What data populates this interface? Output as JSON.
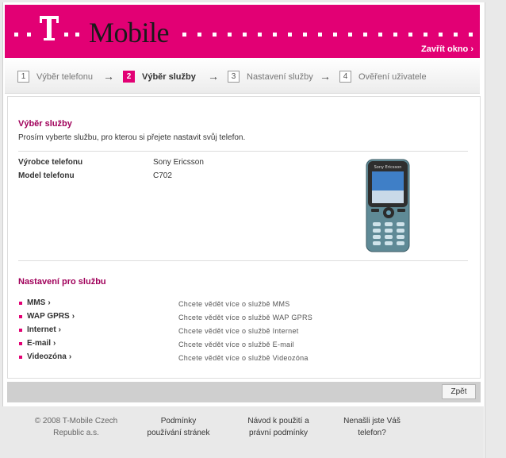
{
  "header": {
    "brand": "Mobile",
    "close_label": "Zavřít okno ›"
  },
  "steps": [
    {
      "num": "1",
      "label": "Výběr telefonu"
    },
    {
      "num": "2",
      "label": "Výběr služby"
    },
    {
      "num": "3",
      "label": "Nastavení služby"
    },
    {
      "num": "4",
      "label": "Ověření uživatele"
    }
  ],
  "step_arrow": "→",
  "selection": {
    "title": "Výběr služby",
    "instruction": "Prosím vyberte službu, pro kterou si přejete nastavit svůj telefon.",
    "manufacturer_label": "Výrobce telefonu",
    "manufacturer_value": "Sony Ericsson",
    "model_label": "Model telefonu",
    "model_value": "C702",
    "phone_brand_text": "Sony Ericsson"
  },
  "services_title": "Nastavení pro službu",
  "services": [
    {
      "name": "MMS",
      "desc": "Chcete vědět více o službě MMS"
    },
    {
      "name": "WAP GPRS",
      "desc": "Chcete vědět více o službě WAP GPRS"
    },
    {
      "name": "Internet",
      "desc": "Chcete vědět více o službě Internet"
    },
    {
      "name": "E-mail",
      "desc": "Chcete vědět více o službě E-mail"
    },
    {
      "name": "Videozóna",
      "desc": "Chcete vědět více o službě Videozóna"
    }
  ],
  "chevron": "›",
  "back_button": "Zpět",
  "footer": {
    "copyright_l1": "© 2008 T-Mobile Czech",
    "copyright_l2": "Republic a.s.",
    "terms_l1": "Podmínky",
    "terms_l2": "používání stránek",
    "guide_l1": "Návod k použití a",
    "guide_l2": "právní podmínky",
    "found_l1": "Nenašli jste Váš",
    "found_l2": "telefon?"
  },
  "colors": {
    "magenta": "#e20074",
    "heading": "#a0005a"
  }
}
